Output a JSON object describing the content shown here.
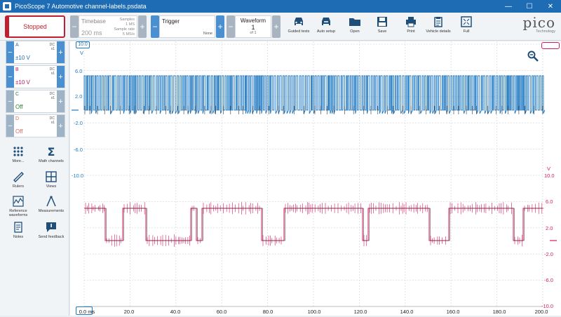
{
  "window": {
    "title": "PicoScope 7 Automotive channel-labels.psdata",
    "minimize": "—",
    "maximize": "☐",
    "close": "✕"
  },
  "toolbar": {
    "run_state": "Stopped",
    "timebase": {
      "label": "Timebase",
      "value": "200 ms",
      "samples_label": "Samples",
      "samples_value": "1 MS",
      "rate_label": "Sample rate",
      "rate_value": "5 MS/s"
    },
    "trigger": {
      "label": "Trigger",
      "mode": "None"
    },
    "waveform": {
      "label": "Waveform",
      "value": "1",
      "of": "of 1"
    },
    "tools": [
      {
        "label": "Guided tests",
        "icon": "car-icon"
      },
      {
        "label": "Auto setup",
        "icon": "car-auto-icon"
      },
      {
        "label": "Open",
        "icon": "folder-icon"
      },
      {
        "label": "Save",
        "icon": "save-icon"
      },
      {
        "label": "Print",
        "icon": "printer-icon"
      },
      {
        "label": "Vehicle details",
        "icon": "clipboard-icon"
      },
      {
        "label": "Full",
        "icon": "fullscreen-icon"
      }
    ],
    "brand": {
      "name": "pico",
      "sub": "Technology"
    }
  },
  "channels": [
    {
      "name": "A",
      "coupling": "DC",
      "probe": "x1",
      "range": "±10 V",
      "color": "#1e6cb4",
      "enabled": true
    },
    {
      "name": "B",
      "coupling": "DC",
      "probe": "x1",
      "range": "±10 V",
      "color": "#c2185b",
      "enabled": true
    },
    {
      "name": "C",
      "coupling": "DC",
      "probe": "x1",
      "range": "Off",
      "color": "#2e7d32",
      "enabled": false
    },
    {
      "name": "D",
      "coupling": "DC",
      "probe": "x1",
      "range": "Off",
      "color": "#d26a6a",
      "enabled": false
    }
  ],
  "side_tools": [
    {
      "label": "More...",
      "icon": "grid-dots-icon"
    },
    {
      "label": "Math channels",
      "icon": "sigma-icon"
    },
    {
      "label": "Rulers",
      "icon": "ruler-icon"
    },
    {
      "label": "Views",
      "icon": "views-grid-icon"
    },
    {
      "label": "Reference waveforms",
      "icon": "reference-waveform-icon"
    },
    {
      "label": "Measurements",
      "icon": "measurements-icon"
    },
    {
      "label": "Notes",
      "icon": "notes-icon"
    },
    {
      "label": "Send feedback",
      "icon": "feedback-icon"
    }
  ],
  "scope": {
    "left_axis_unit": "V",
    "left_axis_top": "10.0",
    "left_ticks": [
      "6.0",
      "2.0",
      "-2.0",
      "-6.0",
      "-10.0"
    ],
    "right_axis_unit": "V",
    "right_ticks": [
      "10.0",
      "6.0",
      "2.0",
      "-2.0",
      "-6.0",
      "-10.0"
    ],
    "x_ticks": [
      "0.0 ms",
      "20.0",
      "40.0",
      "60.0",
      "80.0",
      "100.0",
      "120.0",
      "140.0",
      "160.0",
      "180.0",
      "200.0"
    ],
    "colors": {
      "channel_a": "#1e78c2",
      "channel_b": "#d81b60",
      "grid": "#d9dde2"
    }
  }
}
